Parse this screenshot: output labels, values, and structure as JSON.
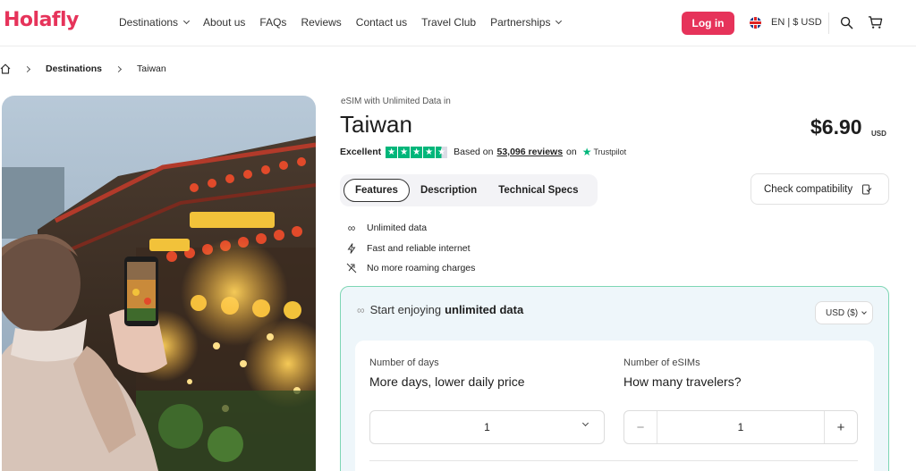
{
  "header": {
    "logo": "Holafly",
    "nav": [
      {
        "label": "Destinations",
        "dropdown": true
      },
      {
        "label": "About us",
        "dropdown": false
      },
      {
        "label": "FAQs",
        "dropdown": false
      },
      {
        "label": "Reviews",
        "dropdown": false
      },
      {
        "label": "Contact us",
        "dropdown": false
      },
      {
        "label": "Travel Club",
        "dropdown": false
      },
      {
        "label": "Partnerships",
        "dropdown": true
      }
    ],
    "login_label": "Log in",
    "language_currency": "EN | $ USD",
    "brand_color": "#e6335a"
  },
  "breadcrumb": {
    "items": [
      "Destinations",
      "Taiwan"
    ]
  },
  "product": {
    "subtitle": "eSIM with Unlimited Data in",
    "title": "Taiwan",
    "price": "$6.90",
    "currency": "USD",
    "rating": {
      "label": "Excellent",
      "stars": 4.5,
      "based_on": "Based on",
      "review_count": "53,096 reviews",
      "on": "on",
      "source": "Trustpilot"
    },
    "tabs": [
      "Features",
      "Description",
      "Technical Specs"
    ],
    "active_tab": "Features",
    "check_compat_label": "Check compatibility",
    "features": [
      {
        "icon": "infinity-icon",
        "text": "Unlimited data"
      },
      {
        "icon": "lightning-icon",
        "text": "Fast and reliable internet"
      },
      {
        "icon": "no-roaming-icon",
        "text": "No more roaming charges"
      }
    ]
  },
  "plan": {
    "heading_prefix": "Start enjoying",
    "heading_bold": "unlimited data",
    "currency_select": "USD ($)",
    "days": {
      "label": "Number of days",
      "title": "More days, lower daily price",
      "value": "1"
    },
    "esims": {
      "label": "Number of eSIMs",
      "title": "How many travelers?",
      "value": "1",
      "minus": "−",
      "plus": "+"
    },
    "accent_border": "#7ed6b4",
    "card_bg": "#eef6fa"
  }
}
